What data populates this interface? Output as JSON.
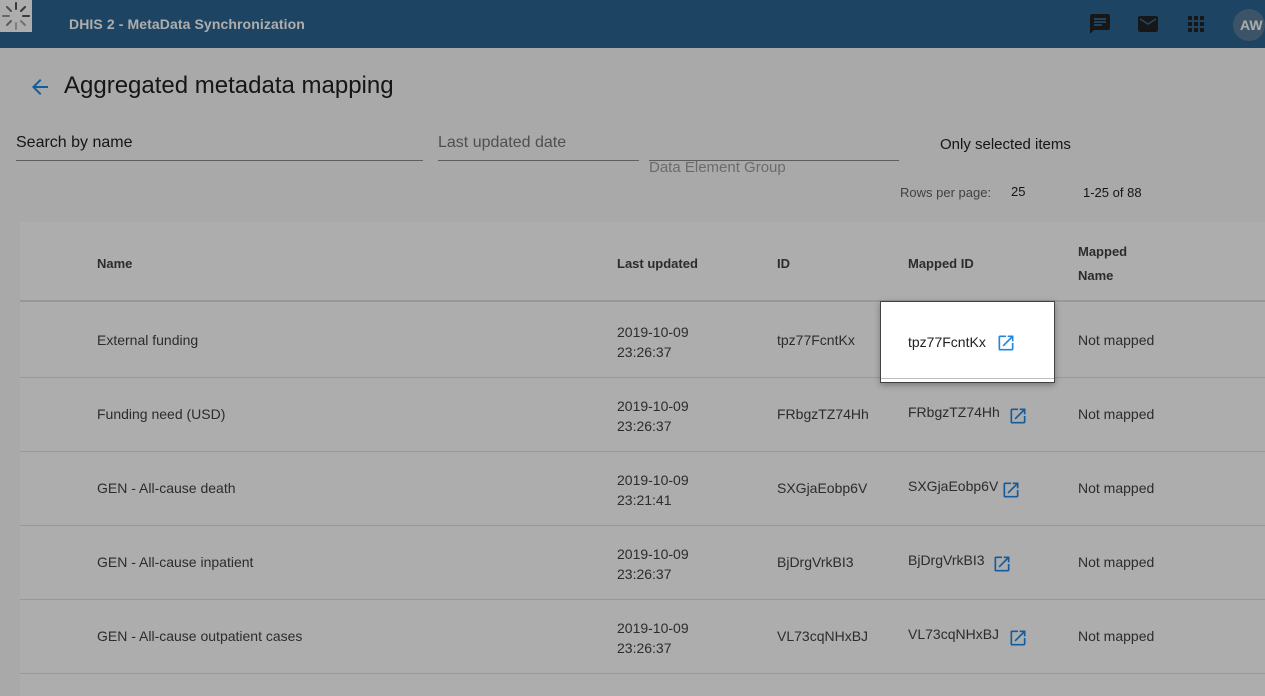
{
  "header": {
    "title": "DHIS 2 - MetaData Synchronization",
    "icons": [
      "chat-icon",
      "mail-icon",
      "apps-icon"
    ],
    "avatar": "AW",
    "color": "#2c6693"
  },
  "page": {
    "title": "Aggregated metadata mapping"
  },
  "filters": {
    "search_placeholder": "Search by name",
    "date_placeholder": "Last updated date",
    "group_placeholder": "Data Element Group",
    "only_selected": "Only selected items"
  },
  "pagination": {
    "rows_per_page_label": "Rows per page:",
    "rows_per_page": "25",
    "range": "1-25 of 88"
  },
  "table": {
    "headers": {
      "name": "Name",
      "last_updated": "Last updated",
      "id": "ID",
      "mapped_id": "Mapped ID",
      "mapped_name_1": "Mapped",
      "mapped_name_2": "Name"
    },
    "rows": [
      {
        "name": "External funding",
        "date": "2019-10-09",
        "time": "23:26:37",
        "id": "tpz77FcntKx",
        "mapped_id": "tpz77FcntKx",
        "mapped_name": "Not mapped"
      },
      {
        "name": "Funding need (USD)",
        "date": "2019-10-09",
        "time": "23:26:37",
        "id": "FRbgzTZ74Hh",
        "mapped_id": "FRbgzTZ74Hh",
        "mapped_name": "Not mapped"
      },
      {
        "name": "GEN - All-cause death",
        "date": "2019-10-09",
        "time": "23:21:41",
        "id": "SXGjaEobp6V",
        "mapped_id": "SXGjaEobp6V",
        "mapped_name": "Not mapped"
      },
      {
        "name": "GEN - All-cause inpatient",
        "date": "2019-10-09",
        "time": "23:26:37",
        "id": "BjDrgVrkBI3",
        "mapped_id": "BjDrgVrkBI3",
        "mapped_name": "Not mapped"
      },
      {
        "name": "GEN - All-cause outpatient cases",
        "date": "2019-10-09",
        "time": "23:26:37",
        "id": "VL73cqNHxBJ",
        "mapped_id": "VL73cqNHxBJ",
        "mapped_name": "Not mapped"
      }
    ]
  },
  "popup": {
    "mapped_id": "tpz77FcntKx"
  },
  "accent": "#1e88e5"
}
